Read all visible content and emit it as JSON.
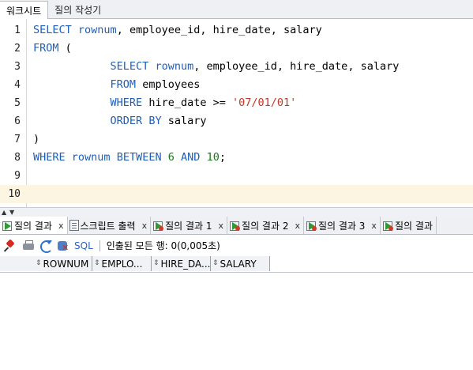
{
  "top_tabs": [
    {
      "label": "워크시트",
      "active": true
    },
    {
      "label": "질의 작성기",
      "active": false
    }
  ],
  "editor": {
    "current_line": 10,
    "lines": [
      {
        "num": "1",
        "tokens": [
          {
            "t": "kw",
            "v": "SELECT"
          },
          {
            "t": "plain",
            "v": " "
          },
          {
            "t": "kw",
            "v": "rownum"
          },
          {
            "t": "plain",
            "v": ", employee_id, hire_date, salary"
          }
        ]
      },
      {
        "num": "2",
        "tokens": [
          {
            "t": "kw",
            "v": "FROM"
          },
          {
            "t": "plain",
            "v": " ("
          }
        ]
      },
      {
        "num": "3",
        "tokens": [
          {
            "t": "plain",
            "v": "            "
          },
          {
            "t": "kw",
            "v": "SELECT"
          },
          {
            "t": "plain",
            "v": " "
          },
          {
            "t": "kw",
            "v": "rownum"
          },
          {
            "t": "plain",
            "v": ", employee_id, hire_date, salary"
          }
        ]
      },
      {
        "num": "4",
        "tokens": [
          {
            "t": "plain",
            "v": "            "
          },
          {
            "t": "kw",
            "v": "FROM"
          },
          {
            "t": "plain",
            "v": " employees"
          }
        ]
      },
      {
        "num": "5",
        "tokens": [
          {
            "t": "plain",
            "v": "            "
          },
          {
            "t": "kw",
            "v": "WHERE"
          },
          {
            "t": "plain",
            "v": " hire_date >= "
          },
          {
            "t": "str",
            "v": "'07/01/01'"
          }
        ]
      },
      {
        "num": "6",
        "tokens": [
          {
            "t": "plain",
            "v": "            "
          },
          {
            "t": "kw",
            "v": "ORDER BY"
          },
          {
            "t": "plain",
            "v": " salary"
          }
        ]
      },
      {
        "num": "7",
        "tokens": [
          {
            "t": "plain",
            "v": ")"
          }
        ]
      },
      {
        "num": "8",
        "tokens": [
          {
            "t": "kw",
            "v": "WHERE"
          },
          {
            "t": "plain",
            "v": " "
          },
          {
            "t": "kw",
            "v": "rownum"
          },
          {
            "t": "plain",
            "v": " "
          },
          {
            "t": "kw",
            "v": "BETWEEN"
          },
          {
            "t": "plain",
            "v": " "
          },
          {
            "t": "num",
            "v": "6"
          },
          {
            "t": "plain",
            "v": " "
          },
          {
            "t": "kw",
            "v": "AND"
          },
          {
            "t": "plain",
            "v": " "
          },
          {
            "t": "num",
            "v": "10"
          },
          {
            "t": "plain",
            "v": ";"
          }
        ]
      },
      {
        "num": "9",
        "tokens": []
      },
      {
        "num": "10",
        "tokens": []
      }
    ]
  },
  "result_tabs": [
    {
      "label": "질의 결과",
      "close": "x",
      "icon": "query-result-icon",
      "error": false,
      "active": true
    },
    {
      "label": "스크립트 출력",
      "close": "x",
      "icon": "script-output-icon",
      "error": false,
      "active": false
    },
    {
      "label": "질의 결과 1",
      "close": "x",
      "icon": "query-result-error-icon",
      "error": true,
      "active": false
    },
    {
      "label": "질의 결과 2",
      "close": "x",
      "icon": "query-result-error-icon",
      "error": true,
      "active": false
    },
    {
      "label": "질의 결과 3",
      "close": "x",
      "icon": "query-result-error-icon",
      "error": true,
      "active": false
    },
    {
      "label": "질의 결과",
      "close": "",
      "icon": "query-result-error-icon",
      "error": true,
      "active": false
    }
  ],
  "toolbar": {
    "sql_label": "SQL",
    "status": "인출된 모든 행: 0(0,005초)"
  },
  "grid": {
    "columns": [
      "ROWNUM",
      "EMPLO...",
      "HIRE_DA...",
      "SALARY"
    ]
  }
}
